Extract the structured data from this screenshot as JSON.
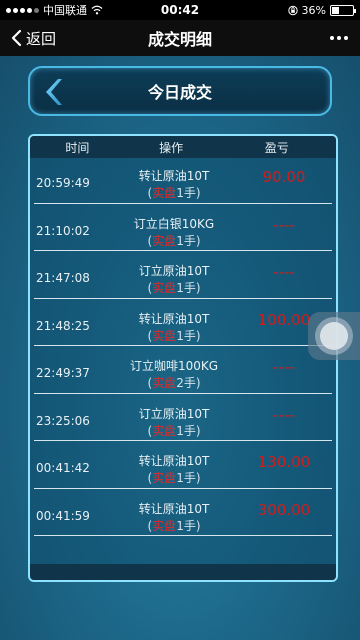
{
  "status_bar": {
    "carrier": "中国联通",
    "time": "00:42",
    "battery_percent": "36%",
    "battery_level": 0.36
  },
  "nav": {
    "back_label": "返回",
    "title": "成交明细"
  },
  "header": {
    "title": "今日成交"
  },
  "table": {
    "columns": [
      "时间",
      "操作",
      "盈亏"
    ],
    "rows": [
      {
        "time": "20:59:49",
        "action": "转让原油10T",
        "tag": "实盘",
        "lots": "1手",
        "pl": "90.00"
      },
      {
        "time": "21:10:02",
        "action": "订立白银10KG",
        "tag": "实盘",
        "lots": "1手",
        "pl": "----"
      },
      {
        "time": "21:47:08",
        "action": "订立原油10T",
        "tag": "实盘",
        "lots": "1手",
        "pl": "----"
      },
      {
        "time": "21:48:25",
        "action": "转让原油10T",
        "tag": "实盘",
        "lots": "1手",
        "pl": "100.00"
      },
      {
        "time": "22:49:37",
        "action": "订立咖啡100KG",
        "tag": "实盘",
        "lots": "2手",
        "pl": "----"
      },
      {
        "time": "23:25:06",
        "action": "订立原油10T",
        "tag": "实盘",
        "lots": "1手",
        "pl": "----"
      },
      {
        "time": "00:41:42",
        "action": "转让原油10T",
        "tag": "实盘",
        "lots": "1手",
        "pl": "130.00"
      },
      {
        "time": "00:41:59",
        "action": "转让原油10T",
        "tag": "实盘",
        "lots": "1手",
        "pl": "300.00"
      }
    ]
  },
  "colors": {
    "accent_border": "#49b9e6",
    "loss_profit_red": "#cc1f1f",
    "tag_red": "#e02b2b"
  }
}
